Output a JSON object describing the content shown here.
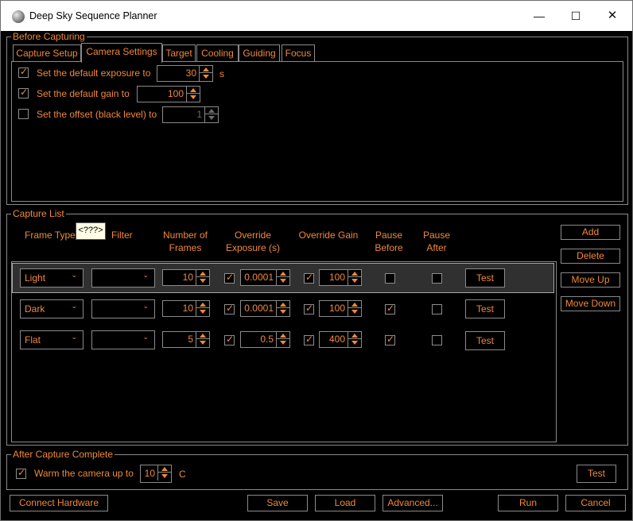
{
  "window": {
    "title": "Deep Sky Sequence Planner",
    "min": "—",
    "max": "☐",
    "close": "✕"
  },
  "before": {
    "legend": "Before Capturing",
    "tabs": [
      "Capture Setup",
      "Camera Settings",
      "Target",
      "Cooling",
      "Guiding",
      "Focus"
    ],
    "active_tab": "Camera Settings",
    "exposure": {
      "label": "Set the default exposure to",
      "value": "30",
      "unit": "s",
      "checked": true
    },
    "gain": {
      "label": "Set the default gain to",
      "value": "100",
      "checked": true
    },
    "offset": {
      "label": "Set the offset (black level) to",
      "value": "1",
      "checked": false
    }
  },
  "capture": {
    "legend": "Capture List",
    "tooltip": "<???>",
    "headers": {
      "frame_type": "Frame Type",
      "filter": "Filter",
      "number": "Number of\nFrames",
      "override_exposure": "Override\nExposure (s)",
      "override_gain": "Override Gain",
      "pause_before": "Pause\nBefore",
      "pause_after": "Pause\nAfter"
    },
    "rows": [
      {
        "frame_type": "Light",
        "filter": "",
        "frames": "10",
        "exp_on": true,
        "exposure": "0.0001",
        "gain_on": true,
        "gain": "100",
        "pause_before": false,
        "pause_after": false,
        "test": "Test"
      },
      {
        "frame_type": "Dark",
        "filter": "",
        "frames": "10",
        "exp_on": true,
        "exposure": "0.0001",
        "gain_on": true,
        "gain": "100",
        "pause_before": true,
        "pause_after": false,
        "test": "Test"
      },
      {
        "frame_type": "Flat",
        "filter": "",
        "frames": "5",
        "exp_on": true,
        "exposure": "0.5",
        "gain_on": true,
        "gain": "400",
        "pause_before": true,
        "pause_after": false,
        "test": "Test"
      }
    ],
    "buttons": {
      "add": "Add",
      "delete": "Delete",
      "move_up": "Move Up",
      "move_down": "Move Down"
    }
  },
  "after": {
    "legend": "After Capture Complete",
    "warm_label": "Warm the camera up to",
    "warm_value": "10",
    "unit": "C",
    "warm_checked": true,
    "test": "Test"
  },
  "footer": {
    "connect": "Connect Hardware",
    "save": "Save",
    "load": "Load",
    "advanced": "Advanced...",
    "run": "Run",
    "cancel": "Cancel"
  },
  "colors": {
    "accent": "#f0883a",
    "background": "#000000",
    "border": "#8a8a8a"
  }
}
